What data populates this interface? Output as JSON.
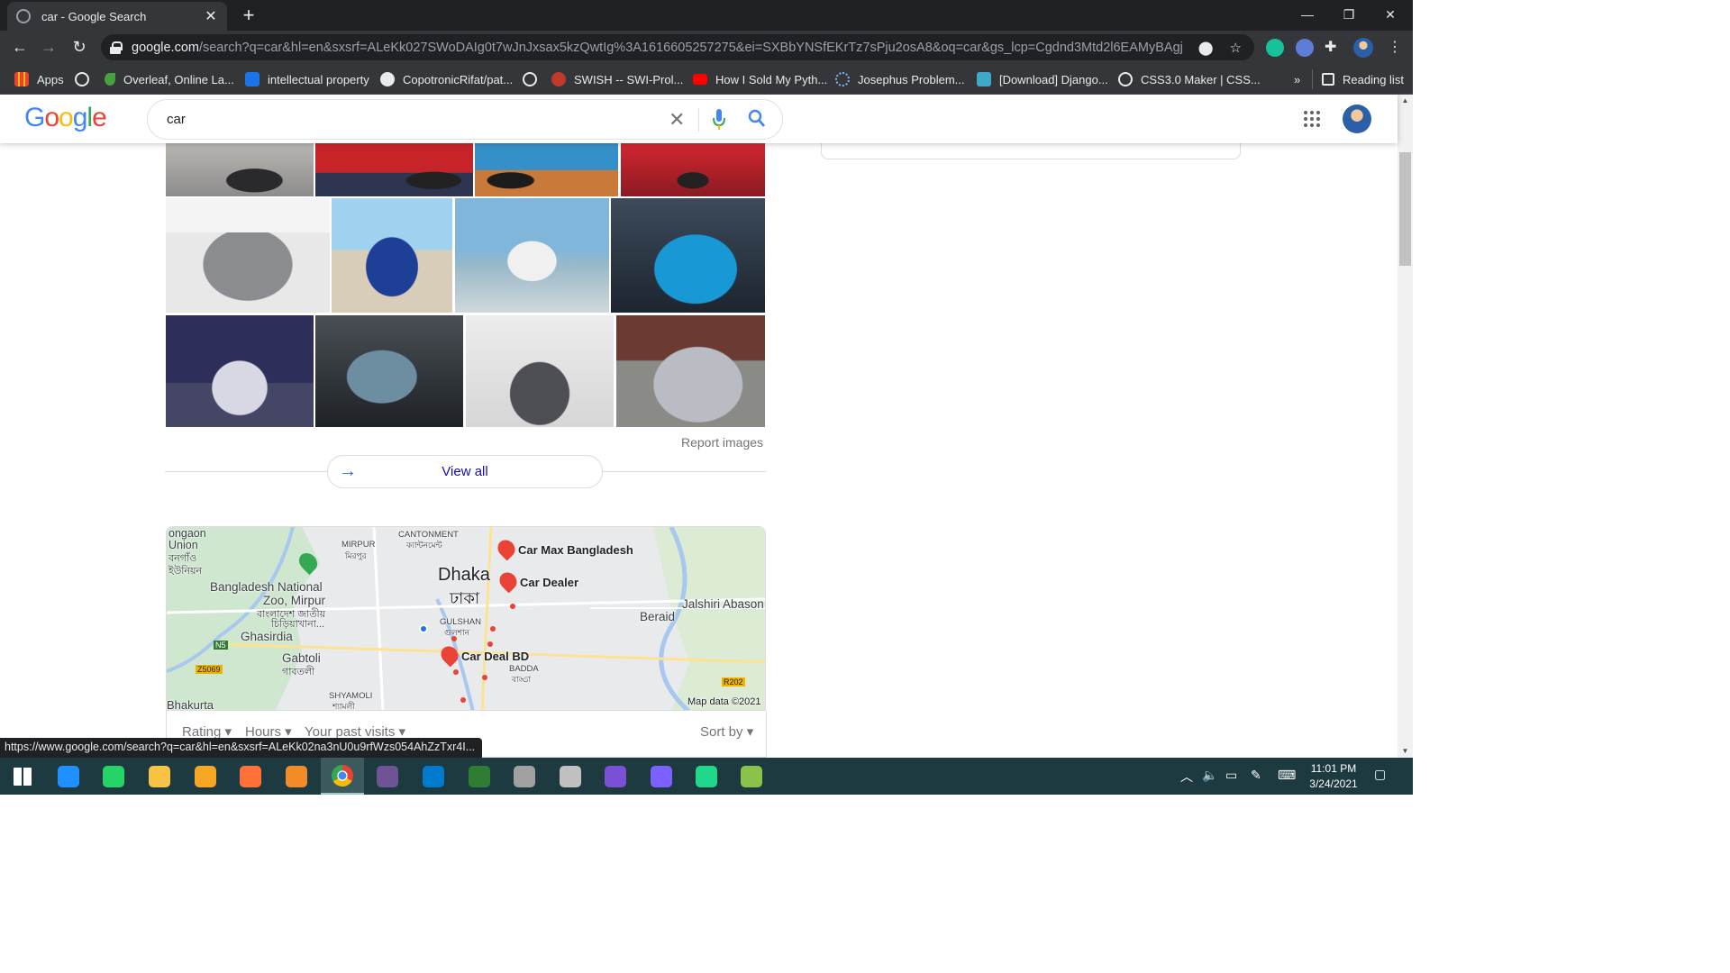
{
  "browser": {
    "tab_title": "car - Google Search",
    "new_tab_symbol": "+",
    "url_host": "google.com",
    "url_rest": "/search?q=car&hl=en&sxsrf=ALeKk027SWoDAIg0t7wJnJxsax5kzQwtIg%3A1616605257275&ei=SXBbYNSfEKrTz7sPju2osA8&oq=car&gs_lcp=Cgdnd3Mtd2l6EAMyBAgjECcy...",
    "bookmarks": [
      {
        "label": "Apps",
        "icon": "apps-grid-icon",
        "color": "#f28b82"
      },
      {
        "label": "",
        "icon": "globe-icon",
        "color": "#e8eaed"
      },
      {
        "label": "Overleaf, Online La...",
        "icon": "overleaf-icon",
        "color": "#47a141"
      },
      {
        "label": "intellectual property",
        "icon": "scribd-icon",
        "color": "#1a73e8"
      },
      {
        "label": "CopotronicRifat/pat...",
        "icon": "github-icon",
        "color": "#e8eaed"
      },
      {
        "label": "",
        "icon": "globe-icon",
        "color": "#e8eaed"
      },
      {
        "label": "SWISH -- SWI-Prol...",
        "icon": "swish-icon",
        "color": "#c0392b"
      },
      {
        "label": "How I Sold My Pyth...",
        "icon": "youtube-icon",
        "color": "#ff0000"
      },
      {
        "label": "Josephus Problem...",
        "icon": "loading-icon",
        "color": "#8ab4f8"
      },
      {
        "label": "[Download] Django...",
        "icon": "django-icon",
        "color": "#3fa9c8"
      },
      {
        "label": "CSS3.0 Maker | CSS...",
        "icon": "globe-icon",
        "color": "#e8eaed"
      }
    ],
    "overflow_label": "»",
    "reading_list": "Reading list",
    "status_url": "https://www.google.com/search?q=car&hl=en&sxsrf=ALeKk02na3nU0u9rfWzs054AhZzTxr4I..."
  },
  "google": {
    "logo": "Google",
    "query": "car",
    "report_images": "Report images",
    "view_all": "View all",
    "map": {
      "attribution": "Map data ©2021",
      "places": [
        "Car Max Bangladesh",
        "Car Dealer",
        "Car Deal BD"
      ],
      "labels": {
        "dhaka": "Dhaka",
        "dhaka_bn": "ঢাকা",
        "cantonment": "CANTONMENT",
        "cantonment_bn": "ক্যান্টনমেন্ট",
        "mirpur": "MIRPUR",
        "mirpur_bn": "মিরপুর",
        "zoo1": "Bangladesh National",
        "zoo2": "Zoo, Mirpur",
        "zoo_bn1": "বাংলাদেশ জাতীয়",
        "zoo_bn2": "চিড়িয়াখানা...",
        "tongi1": "ongaon",
        "tongi2": "Union",
        "tongi_bn1": "বনগাঁও",
        "tongi_bn2": "ইউনিয়ন",
        "ghasirdia": "Ghasirdia",
        "gabtoli": "Gabtoli",
        "gabtoli_bn": "গাবতলী",
        "gulshan": "GULSHAN",
        "gulshan_bn": "গুলশান",
        "badda": "BADDA",
        "badda_bn": "বাড্ডা",
        "beraid": "Beraid",
        "jalshiri": "Jalshiri Abason",
        "shyamoli": "SHYAMOLI",
        "shyamoli_bn": "শ্যামলী",
        "bhakurta": "Bhakurta",
        "n5": "N5",
        "z5069": "Z5069",
        "r202": "R202"
      }
    },
    "filters": [
      "Rating",
      "Hours",
      "Your past visits"
    ],
    "sort_by": "Sort by"
  },
  "taskbar": {
    "time": "11:01 PM",
    "date": "3/24/2021",
    "apps": [
      {
        "name": "start-icon",
        "color": "#ffffff"
      },
      {
        "name": "search-app-icon",
        "color": "#1e90ff"
      },
      {
        "name": "whatsapp-icon",
        "color": "#25d366"
      },
      {
        "name": "file-explorer-icon",
        "color": "#f6c344"
      },
      {
        "name": "vpn-icon",
        "color": "#f5a623"
      },
      {
        "name": "firefox-icon",
        "color": "#ff7139"
      },
      {
        "name": "zip-icon",
        "color": "#f28c28"
      },
      {
        "name": "chrome-icon",
        "color": "#34a853"
      },
      {
        "name": "github-desktop-icon",
        "color": "#6e5494"
      },
      {
        "name": "vscode-icon",
        "color": "#007acc"
      },
      {
        "name": "maps-app-icon",
        "color": "#2e7d32"
      },
      {
        "name": "hat-app-icon",
        "color": "#a0a0a0"
      },
      {
        "name": "mic-app-icon",
        "color": "#c0c0c0"
      },
      {
        "name": "visual-studio-icon",
        "color": "#7b4fd6"
      },
      {
        "name": "messenger-icon",
        "color": "#7b61ff"
      },
      {
        "name": "pycharm-icon",
        "color": "#21d789"
      },
      {
        "name": "excel-app-icon",
        "color": "#8bc34a"
      }
    ]
  }
}
